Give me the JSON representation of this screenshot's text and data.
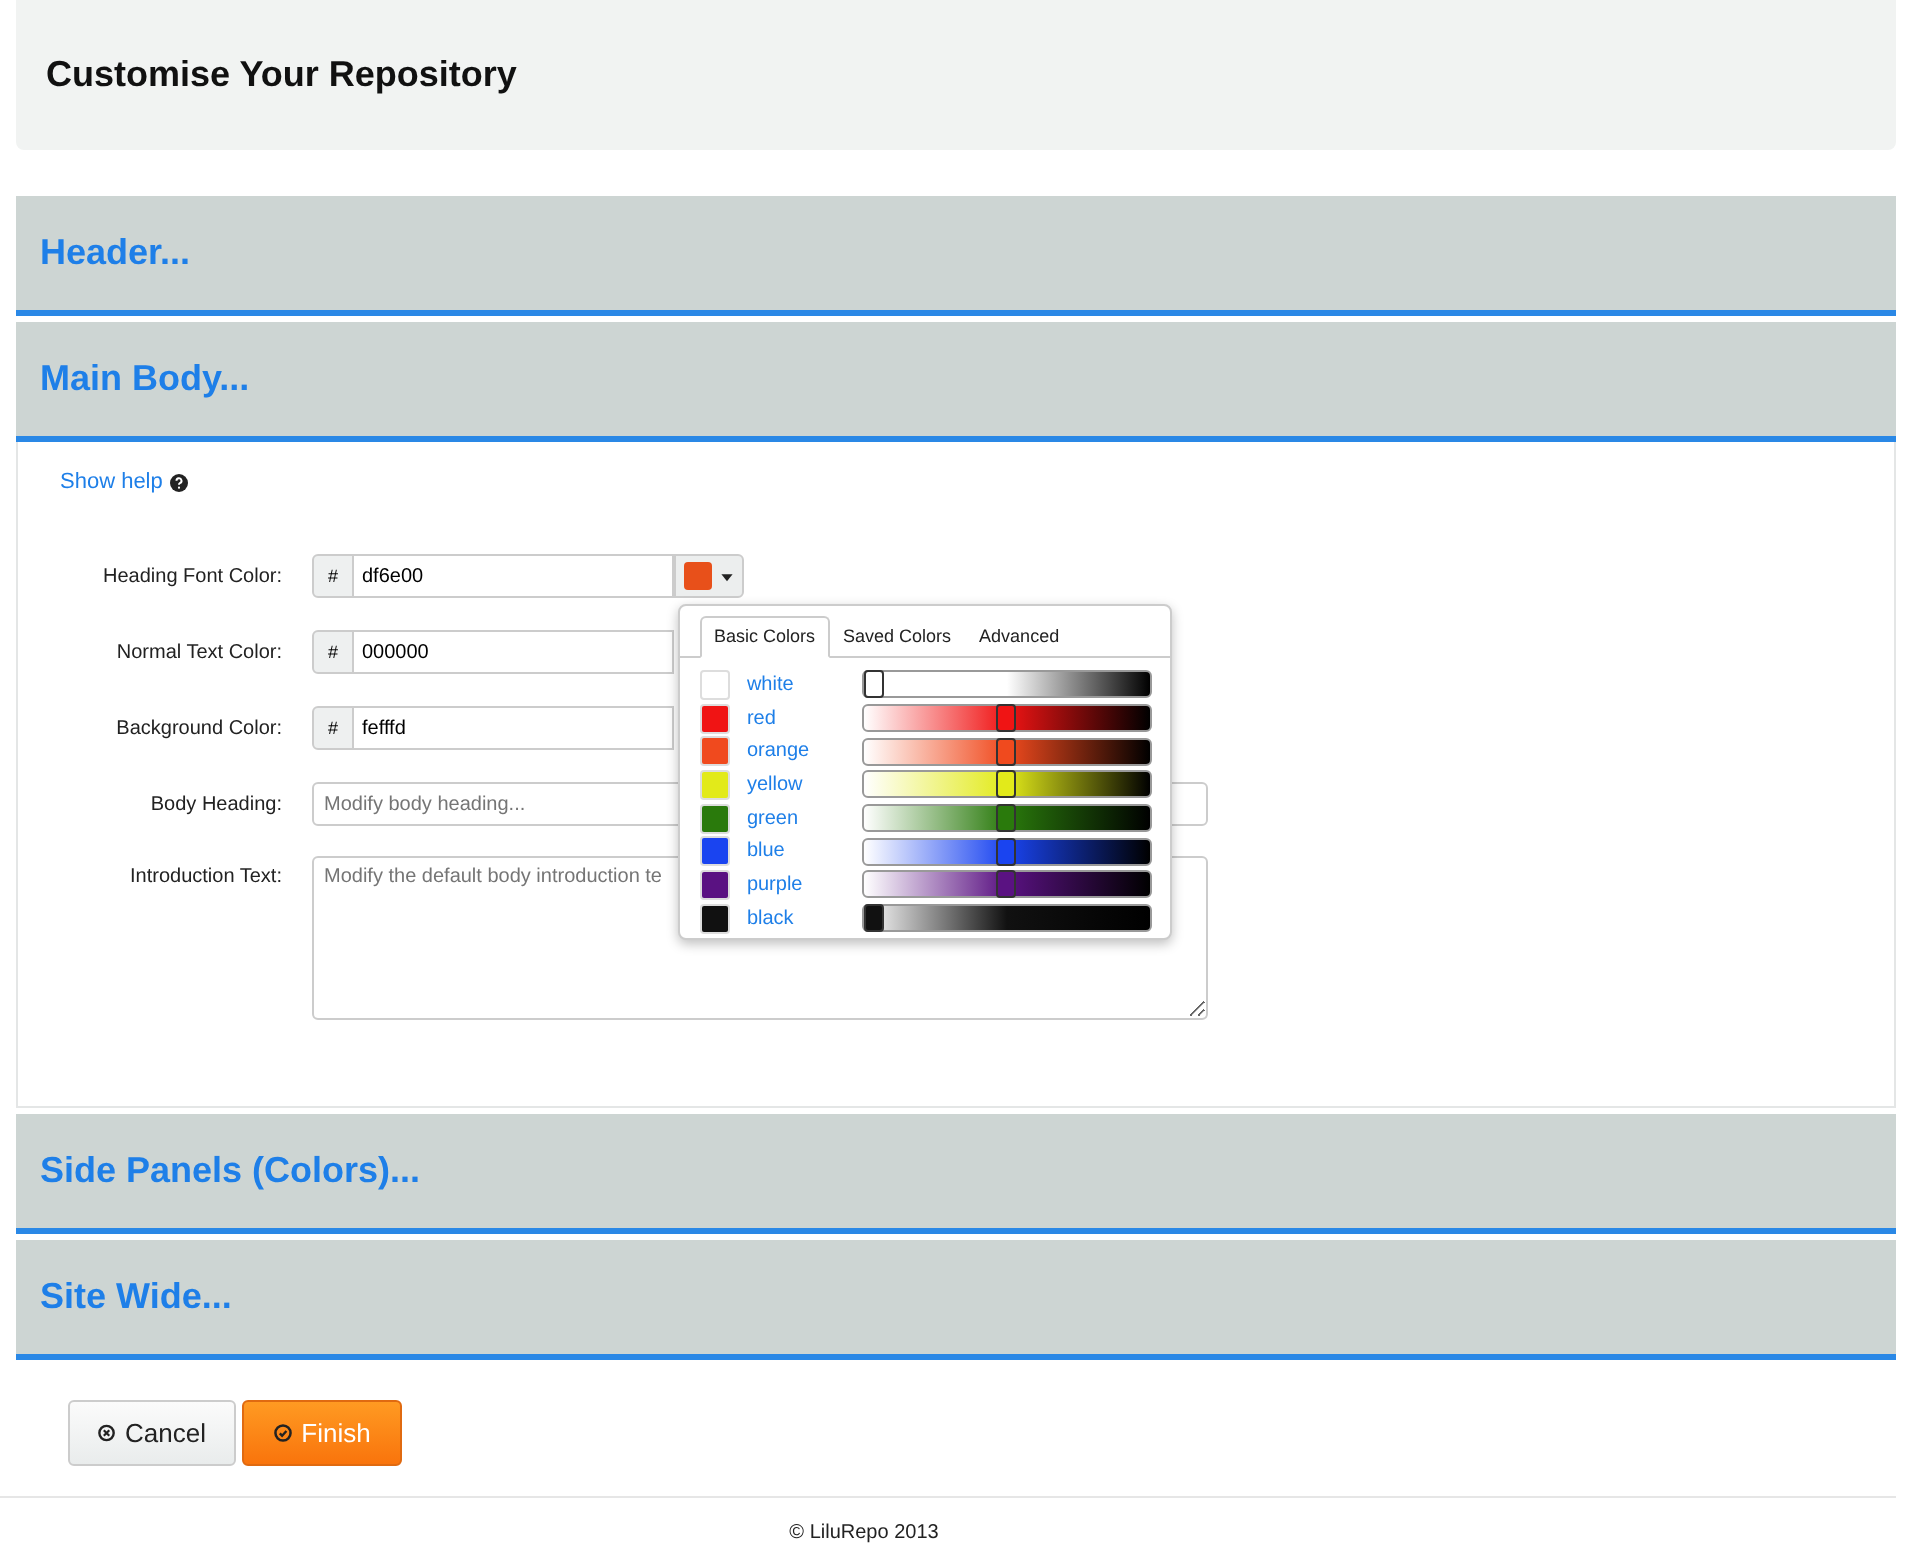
{
  "page_title": "Customise Your Repository",
  "sections": [
    {
      "title": "Header...",
      "expanded": false
    },
    {
      "title": "Main Body...",
      "expanded": true,
      "help_link": "Show help",
      "fields": [
        {
          "kind": "color",
          "label": "Heading Font Color:",
          "prefix": "#",
          "value": "df6e00",
          "color": "#e8501a",
          "picker_open": true
        },
        {
          "kind": "color",
          "label": "Normal Text Color:",
          "prefix": "#",
          "value": "000000",
          "picker_open": false
        },
        {
          "kind": "color",
          "label": "Background Color:",
          "prefix": "#",
          "value": "fefffd",
          "picker_open": false
        },
        {
          "kind": "text",
          "label": "Body Heading:",
          "placeholder": "Modify body heading..."
        },
        {
          "kind": "textarea",
          "label": "Introduction Text:",
          "placeholder": "Modify the default body introduction te"
        }
      ],
      "color_picker": {
        "tabs": [
          {
            "label": "Basic Colors",
            "selected": true
          },
          {
            "label": "Saved Colors",
            "selected": false
          },
          {
            "label": "Advanced",
            "selected": false
          }
        ],
        "colors": [
          {
            "name": "white",
            "color": "#ffffff",
            "level": 0.0
          },
          {
            "name": "red",
            "color": "#f01414",
            "level": 0.5
          },
          {
            "name": "orange",
            "color": "#f04a1e",
            "level": 0.5
          },
          {
            "name": "yellow",
            "color": "#e2ea1a",
            "level": 0.5
          },
          {
            "name": "green",
            "color": "#2a7a0c",
            "level": 0.5
          },
          {
            "name": "blue",
            "color": "#1a44f0",
            "level": 0.5
          },
          {
            "name": "purple",
            "color": "#5a1282",
            "level": 0.5
          },
          {
            "name": "black",
            "color": "#111111",
            "level": 0.0
          }
        ]
      }
    },
    {
      "title": "Side Panels (Colors)...",
      "expanded": false
    },
    {
      "title": "Site Wide...",
      "expanded": false
    }
  ],
  "buttons": [
    {
      "kind": "cancel",
      "label": "Cancel"
    },
    {
      "kind": "primary",
      "label": "Finish"
    }
  ],
  "footer": "© LiluRepo 2013"
}
